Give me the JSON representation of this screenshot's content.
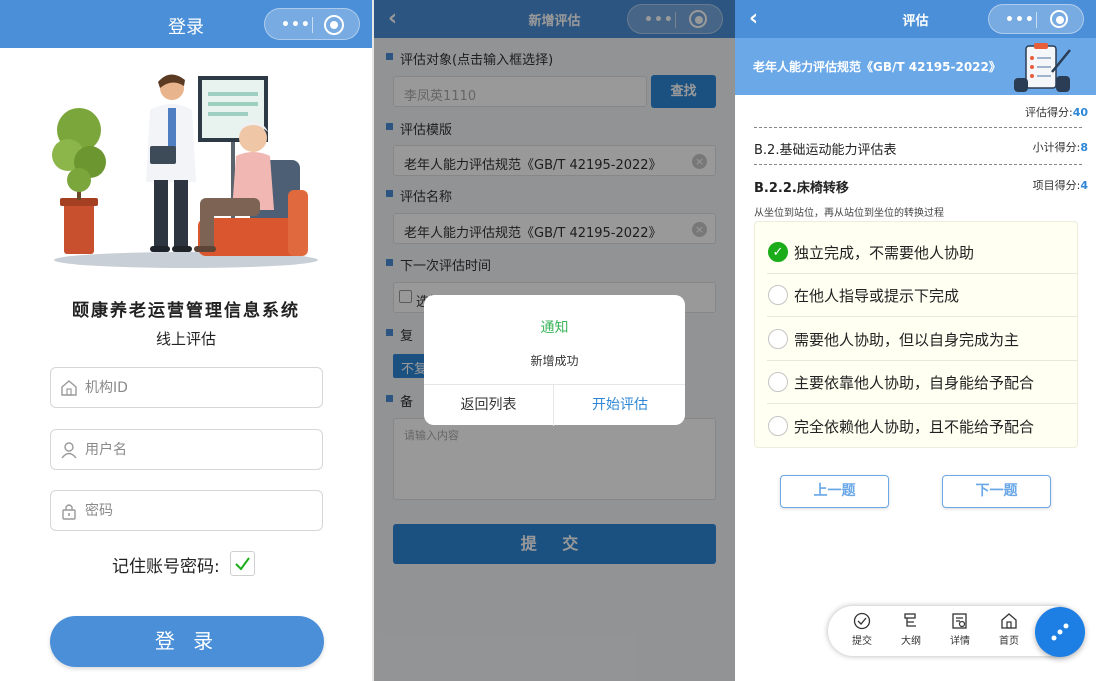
{
  "login": {
    "title": "登录",
    "system_name": "颐康养老运营管理信息系统",
    "subtitle": "线上评估",
    "org_placeholder": "机构ID",
    "user_placeholder": "用户名",
    "pwd_placeholder": "密码",
    "remember_label": "记住账号密码:",
    "remember_checked": true,
    "login_button": "登 录"
  },
  "add": {
    "title": "新增评估",
    "target_label": "评估对象(点击输入框选择)",
    "target_value": "李凤英1110",
    "find_button": "查找",
    "template_label": "评估模版",
    "template_value": "老年人能力评估规范《GB/T 42195-2022》",
    "name_label": "评估名称",
    "name_value": "老年人能力评估规范《GB/T 42195-2022》",
    "next_time_label": "下一次评估时间",
    "date_placeholder": "选择日期",
    "repeat_label_partial": "复",
    "repeat_button_partial": "不复",
    "remark_label_partial": "备",
    "remark_placeholder": "请输入内容",
    "submit_button": "提 交",
    "dialog": {
      "title": "通知",
      "message": "新增成功",
      "cancel": "返回列表",
      "confirm": "开始评估"
    }
  },
  "eval": {
    "title": "评估",
    "banner": "老年人能力评估规范《GB/T 42195-2022》",
    "total_label": "评估得分:",
    "total_value": "40",
    "section": "B.2.基础运动能力评估表",
    "subtotal_label": "小计得分:",
    "subtotal_value": "8",
    "item": "B.2.2.床椅转移",
    "item_score_label": "项目得分:",
    "item_score_value": "4",
    "description": "从坐位到站位，再从站位到坐位的转换过程",
    "options": [
      {
        "text": "独立完成，不需要他人协助",
        "selected": true
      },
      {
        "text": "在他人指导或提示下完成",
        "selected": false
      },
      {
        "text": "需要他人协助，但以自身完成为主",
        "selected": false
      },
      {
        "text": "主要依靠他人协助，自身能给予配合",
        "selected": false
      },
      {
        "text": "完全依赖他人协助，且不能给予配合",
        "selected": false
      }
    ],
    "prev_button": "上一题",
    "next_button": "下一题",
    "tabs": [
      {
        "label": "提交",
        "icon": "check-circle-icon"
      },
      {
        "label": "大纲",
        "icon": "outline-icon"
      },
      {
        "label": "详情",
        "icon": "details-icon"
      },
      {
        "label": "首页",
        "icon": "home-icon"
      }
    ]
  },
  "colors": {
    "primary": "#4a8fd8",
    "button": "#2d87d6",
    "success": "#1aad19",
    "dialog_title": "#3cb55b"
  }
}
